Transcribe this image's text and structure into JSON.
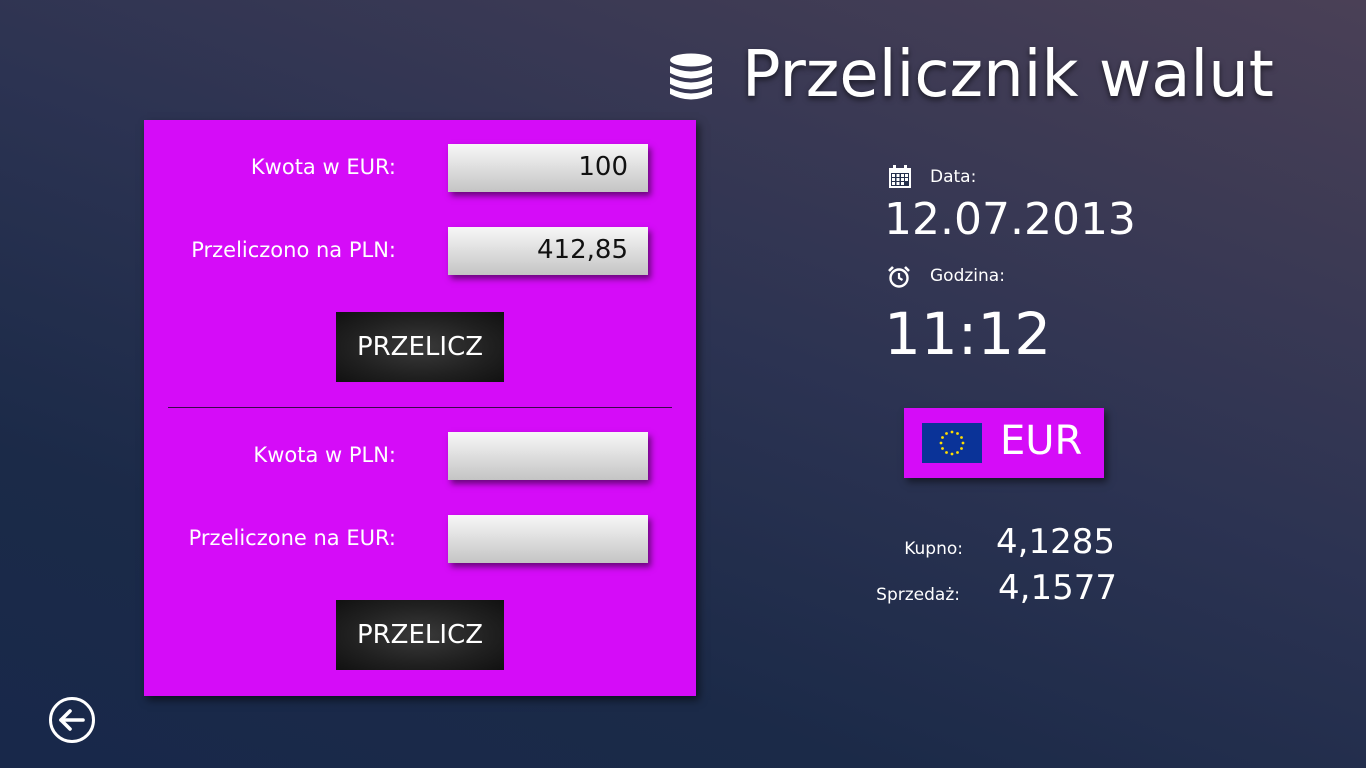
{
  "header": {
    "title": "Przelicznik walut",
    "icon": "database-icon"
  },
  "converter": {
    "eur_to_pln": {
      "amount_label": "Kwota w EUR:",
      "amount_value": "100",
      "result_label": "Przeliczono na PLN:",
      "result_value": "412,85",
      "button_label": "PRZELICZ"
    },
    "pln_to_eur": {
      "amount_label": "Kwota w PLN:",
      "amount_value": "",
      "result_label": "Przeliczone na EUR:",
      "result_value": "",
      "button_label": "PRZELICZ"
    }
  },
  "info": {
    "date_label": "Data:",
    "date_value": "12.07.2013",
    "date_icon": "calendar-icon",
    "time_label": "Godzina:",
    "time_value": "11:12",
    "time_icon": "alarm-clock-icon"
  },
  "currency": {
    "code": "EUR",
    "flag_icon": "eu-flag-icon"
  },
  "rates": {
    "buy_label": "Kupno:",
    "buy_value": "4,1285",
    "sell_label": "Sprzedaż:",
    "sell_value": "4,1577"
  },
  "navigation": {
    "back_icon": "back-arrow-icon"
  },
  "colors": {
    "accent": "#d50cf8",
    "background_top": "#4a4056",
    "background_bottom": "#18284a",
    "button_dark": "#1a1a1a"
  }
}
